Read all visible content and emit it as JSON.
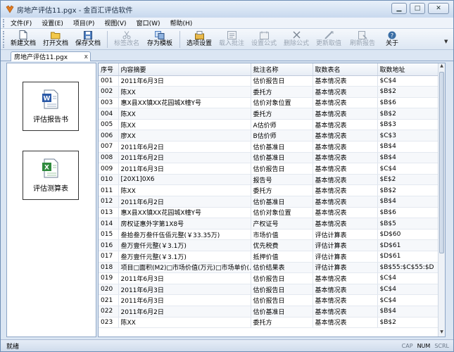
{
  "window": {
    "title": "房地产评估11.pgx - 金百汇评估软件",
    "controls": {
      "minimize": "▁",
      "maximize": "□",
      "close": "✕"
    }
  },
  "menu": [
    "文件(F)",
    "设置(E)",
    "项目(P)",
    "视图(V)",
    "窗口(W)",
    "帮助(H)"
  ],
  "toolbar": [
    {
      "label": "新建文档",
      "icon": "new-document-icon",
      "enabled": true
    },
    {
      "label": "打开文档",
      "icon": "open-folder-icon",
      "enabled": true
    },
    {
      "label": "保存文档",
      "icon": "save-disk-icon",
      "enabled": true
    },
    {
      "label": "标签改名",
      "icon": "scissors-icon",
      "enabled": false
    },
    {
      "label": "存为模板",
      "icon": "template-icon",
      "enabled": true
    },
    {
      "label": "选项设置",
      "icon": "options-icon",
      "enabled": true
    },
    {
      "label": "载入批注",
      "icon": "annotation-icon",
      "enabled": false
    },
    {
      "label": "设置公式",
      "icon": "formula-set-icon",
      "enabled": false
    },
    {
      "label": "删除公式",
      "icon": "delete-x-icon",
      "enabled": false
    },
    {
      "label": "更新取值",
      "icon": "update-icon",
      "enabled": false
    },
    {
      "label": "刷新报告",
      "icon": "refresh-icon",
      "enabled": false
    },
    {
      "label": "关于",
      "icon": "help-icon",
      "enabled": true
    }
  ],
  "doc_tab": {
    "label": "房地产评估11.pgx",
    "close": "x"
  },
  "left_panel": {
    "items": [
      {
        "label": "评估报告书",
        "icon": "word-document-icon"
      },
      {
        "label": "评估测算表",
        "icon": "excel-sheet-icon"
      }
    ]
  },
  "grid": {
    "columns": [
      "序号",
      "内容摘要",
      "批注名称",
      "取数表名",
      "取数地址"
    ],
    "rows": [
      [
        "001",
        "2011年6月3日",
        "估价报告日",
        "基本情况表",
        "$C$4"
      ],
      [
        "002",
        "陈XX",
        "委托方",
        "基本情况表",
        "$B$2"
      ],
      [
        "003",
        "惠X县XX镇XX花园城X幢Y号",
        "估价对象位置",
        "基本情况表",
        "$B$6"
      ],
      [
        "004",
        "陈XX",
        "委托方",
        "基本情况表",
        "$B$2"
      ],
      [
        "005",
        "陈XX",
        "A估价师",
        "基本情况表",
        "$B$3"
      ],
      [
        "006",
        "廖XX",
        "B估价师",
        "基本情况表",
        "$C$3"
      ],
      [
        "007",
        "2011年6月2日",
        "估价基准日",
        "基本情况表",
        "$B$4"
      ],
      [
        "008",
        "2011年6月2日",
        "估价基准日",
        "基本情况表",
        "$B$4"
      ],
      [
        "009",
        "2011年6月3日",
        "估价报告日",
        "基本情况表",
        "$C$4"
      ],
      [
        "010",
        "[20X1]0X6",
        "报告号",
        "基本情况表",
        "$E$2"
      ],
      [
        "011",
        "陈XX",
        "委托方",
        "基本情况表",
        "$B$2"
      ],
      [
        "012",
        "2011年6月2日",
        "估价基准日",
        "基本情况表",
        "$B$4"
      ],
      [
        "013",
        "惠X县XX镇XX花园城X幢Y号",
        "估价对象位置",
        "基本情况表",
        "$B$6"
      ],
      [
        "014",
        "房权证惠外字第1X8号",
        "产权证号",
        "基本情况表",
        "$B$5"
      ],
      [
        "015",
        "叁拾叁万叁仟伍佰元整(￥33.35万)",
        "市场价值",
        "评估计算表",
        "$D$60"
      ],
      [
        "016",
        "叁万壹仟元整(￥3.1万)",
        "优先税费",
        "评估计算表",
        "$D$61"
      ],
      [
        "017",
        "叁万壹仟元整(￥3.1万)",
        "抵押价值",
        "评估计算表",
        "$D$61"
      ],
      [
        "018",
        "项目□面积(M2)□市场价值(万元)□市场单价(…",
        "估价结果表",
        "评估计算表",
        "$B$55:$C$55:$D"
      ],
      [
        "019",
        "2011年6月3日",
        "估价报告日",
        "基本情况表",
        "$C$4"
      ],
      [
        "020",
        "2011年6月3日",
        "估价报告日",
        "基本情况表",
        "$C$4"
      ],
      [
        "021",
        "2011年6月3日",
        "估价报告日",
        "基本情况表",
        "$C$4"
      ],
      [
        "022",
        "2011年6月2日",
        "估价基准日",
        "基本情况表",
        "$B$4"
      ],
      [
        "023",
        "陈XX",
        "委托方",
        "基本情况表",
        "$B$2"
      ]
    ]
  },
  "status": {
    "text": "就绪",
    "keys": [
      {
        "label": "CAP",
        "on": false
      },
      {
        "label": "NUM",
        "on": true
      },
      {
        "label": "SCRL",
        "on": false
      }
    ]
  },
  "colors": {
    "accent": "#3a6ea5",
    "frame": "#dbe6f3",
    "grid_border": "#8ea6c6"
  }
}
